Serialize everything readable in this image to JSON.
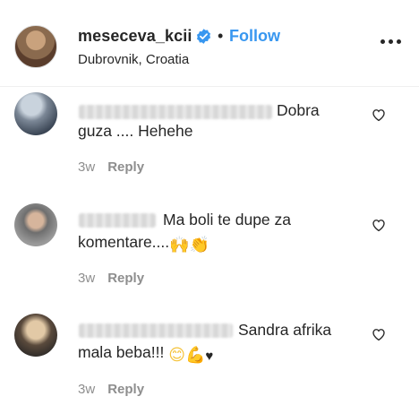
{
  "post_header": {
    "username": "meseceva_kcii",
    "separator": "•",
    "follow_label": "Follow",
    "location": "Dubrovnik, Croatia",
    "verified_icon": "verified-badge-icon",
    "more_icon": "more-options-icon"
  },
  "comments": [
    {
      "text_line1": "Dobra",
      "text_line2": "guza .... Hehehe",
      "time": "3w",
      "reply_label": "Reply"
    },
    {
      "text_line1": "Ma boli te dupe za",
      "text_line2": "komentare....",
      "emojis": [
        "🙌",
        "👏"
      ],
      "time": "3w",
      "reply_label": "Reply"
    },
    {
      "text_line1": "Sandra afrika",
      "text_line2": "mala beba!!!",
      "emojis": [
        "😊",
        "💪",
        "♥"
      ],
      "time": "3w",
      "reply_label": "Reply"
    }
  ],
  "colors": {
    "follow": "#3897f0",
    "verified": "#3897f0",
    "meta": "#8e8e8e"
  }
}
